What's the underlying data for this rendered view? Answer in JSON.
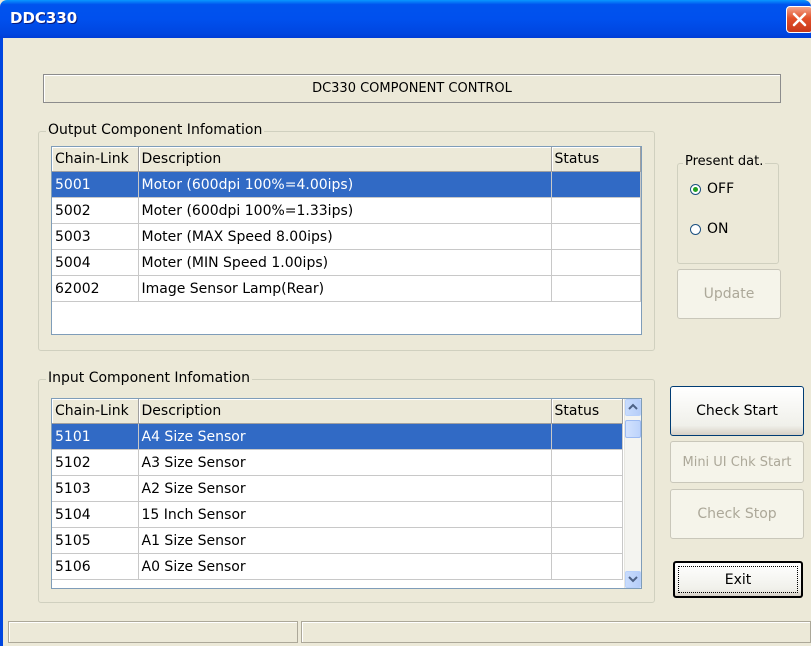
{
  "window": {
    "title": "DDC330"
  },
  "header": {
    "title": "DC330 COMPONENT CONTROL"
  },
  "output": {
    "legend": "Output Component Infomation",
    "columns": [
      "Chain-Link",
      "Description",
      "Status"
    ],
    "rows": [
      {
        "chain": "5001",
        "desc": "Motor (600dpi 100%=4.00ips)",
        "status": ""
      },
      {
        "chain": "5002",
        "desc": "Moter (600dpi 100%=1.33ips)",
        "status": ""
      },
      {
        "chain": "5003",
        "desc": "Moter (MAX Speed 8.00ips)",
        "status": ""
      },
      {
        "chain": "5004",
        "desc": "Moter (MIN Speed 1.00ips)",
        "status": ""
      },
      {
        "chain": "62002",
        "desc": "Image Sensor Lamp(Rear)",
        "status": ""
      }
    ]
  },
  "present": {
    "legend": "Present dat.",
    "options": [
      "OFF",
      "ON"
    ],
    "selected": "OFF"
  },
  "buttons": {
    "update": "Update",
    "check_start": "Check Start",
    "mini_ui": "Mini UI Chk Start",
    "check_stop": "Check Stop",
    "exit": "Exit"
  },
  "input": {
    "legend": "Input Component Infomation",
    "columns": [
      "Chain-Link",
      "Description",
      "Status"
    ],
    "rows": [
      {
        "chain": "5101",
        "desc": "A4 Size Sensor",
        "status": ""
      },
      {
        "chain": "5102",
        "desc": "A3 Size Sensor",
        "status": ""
      },
      {
        "chain": "5103",
        "desc": "A2 Size Sensor",
        "status": ""
      },
      {
        "chain": "5104",
        "desc": "15 Inch Sensor",
        "status": ""
      },
      {
        "chain": "5105",
        "desc": "A1 Size Sensor",
        "status": ""
      },
      {
        "chain": "5106",
        "desc": "A0 Size Sensor",
        "status": ""
      }
    ]
  },
  "colors": {
    "title_bar": "#0053ee",
    "selection": "#316ac5",
    "face": "#ece9d8"
  }
}
